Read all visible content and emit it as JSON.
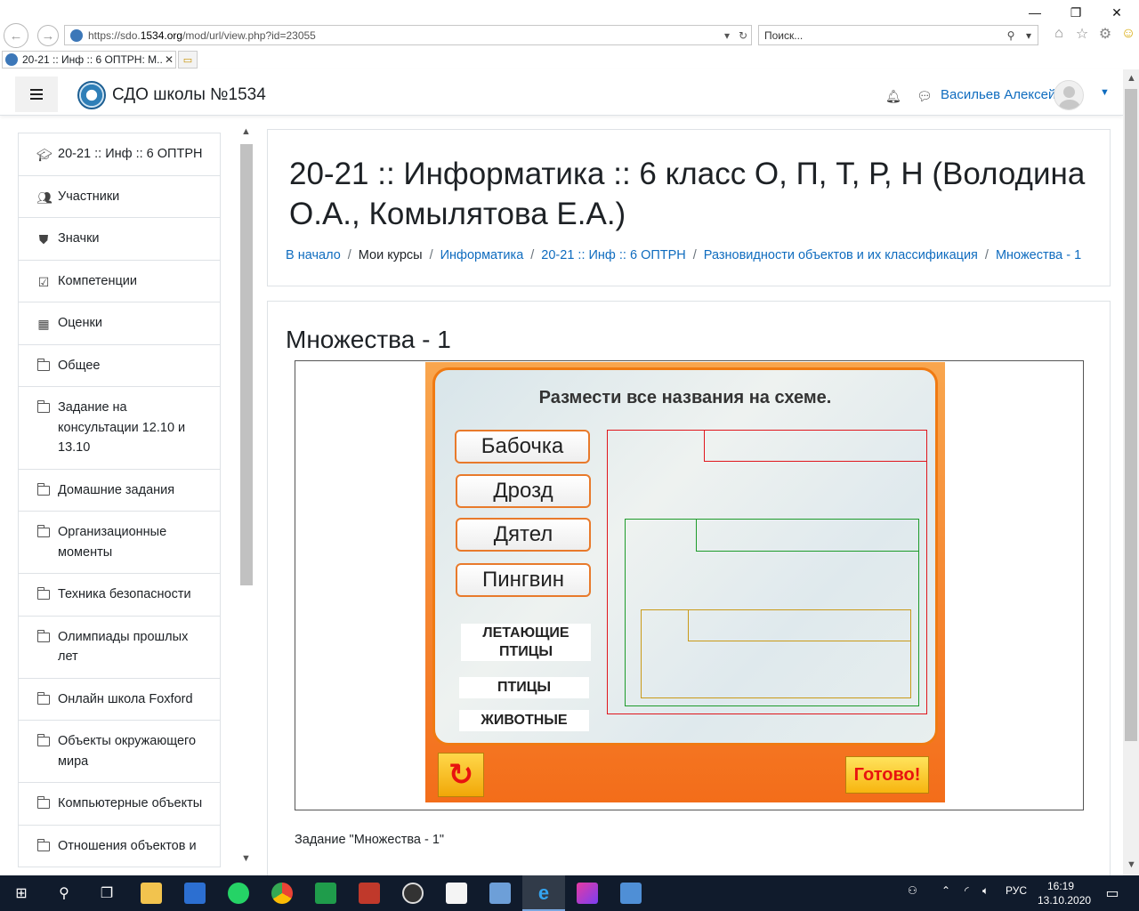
{
  "browser": {
    "url_prefix": "https://sdo.",
    "url_domain": "1534.org",
    "url_path": "/mod/url/view.php?id=23055",
    "search_placeholder": "Поиск...",
    "tab_title": "20-21 :: Инф :: 6 ОПТРН: М...",
    "icons": [
      "back-icon",
      "forward-icon",
      "refresh-icon",
      "search-icon",
      "home-icon",
      "star-icon",
      "gear-icon",
      "smiley-icon"
    ]
  },
  "navbar": {
    "brand": "СДО школы №1534",
    "user_name": "Васильев Алексей"
  },
  "sidebar": {
    "items": [
      {
        "label": "20-21 :: Инф :: 6 ОПТРН",
        "icon": "graduation-cap-icon"
      },
      {
        "label": "Участники",
        "icon": "users-icon"
      },
      {
        "label": "Значки",
        "icon": "shield-icon"
      },
      {
        "label": "Компетенции",
        "icon": "checkbox-icon"
      },
      {
        "label": "Оценки",
        "icon": "table-icon"
      },
      {
        "label": "Общее",
        "icon": "folder-icon"
      },
      {
        "label": "Задание на консультации 12.10 и 13.10",
        "icon": "folder-icon"
      },
      {
        "label": "Домашние задания",
        "icon": "folder-icon"
      },
      {
        "label": "Организационные моменты",
        "icon": "folder-icon"
      },
      {
        "label": "Техника безопасности",
        "icon": "folder-icon"
      },
      {
        "label": "Олимпиады прошлых лет",
        "icon": "folder-icon"
      },
      {
        "label": "Онлайн школа Foxford",
        "icon": "folder-icon"
      },
      {
        "label": "Объекты окружающего мира",
        "icon": "folder-icon"
      },
      {
        "label": "Компьютерные объекты",
        "icon": "folder-icon"
      },
      {
        "label": "Отношения объектов и",
        "icon": "folder-icon"
      }
    ]
  },
  "header": {
    "course_title": "20-21 :: Информатика :: 6 класс О, П, Т, Р, Н (Володина О.А., Комылятова Е.А.)",
    "breadcrumb": [
      {
        "label": "В начало",
        "link": true
      },
      {
        "label": "Мои курсы",
        "link": false
      },
      {
        "label": "Информатика",
        "link": true
      },
      {
        "label": "20-21 :: Инф :: 6 ОПТРН",
        "link": true
      },
      {
        "label": "Разновидности объектов и их классификация",
        "link": true
      },
      {
        "label": "Множества - 1",
        "link": true
      }
    ],
    "separator": "/"
  },
  "content": {
    "activity_title": "Множества - 1",
    "caption": "Задание \"Множества - 1\""
  },
  "game": {
    "task": "Размести все названия на схеме.",
    "words": [
      "Бабочка",
      "Дрозд",
      "Дятел",
      "Пингвин"
    ],
    "categories": [
      "ЛЕТАЮЩИЕ ПТИЦЫ",
      "ПТИЦЫ",
      "ЖИВОТНЫЕ"
    ],
    "ready_label": "Готово!",
    "colors": {
      "animals_set": "#e0161c",
      "birds_set": "#1d9b2a",
      "flying_set": "#c99a18",
      "accent": "#f36d1a"
    }
  },
  "taskbar": {
    "lang": "РУС",
    "time": "16:19",
    "date": "13.10.2020"
  }
}
